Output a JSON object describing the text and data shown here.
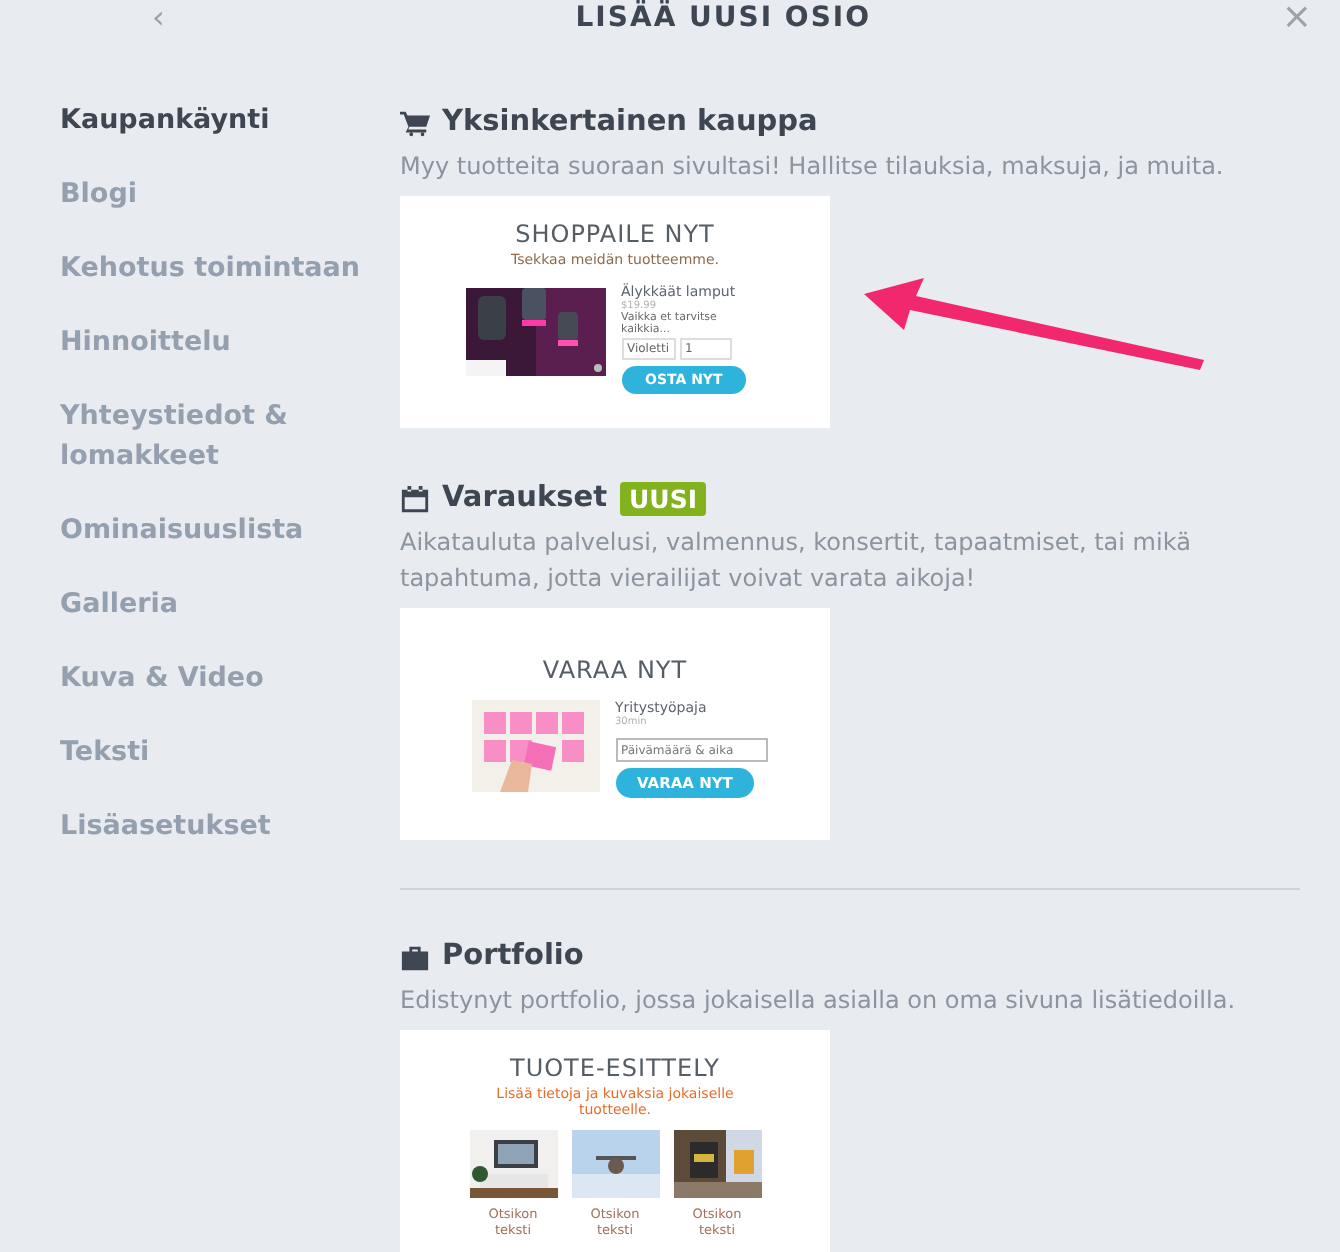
{
  "header": {
    "title": "LISÄÄ UUSI OSIO",
    "back": "‹",
    "close": "×"
  },
  "sidebar": {
    "items": [
      {
        "label": "Kaupankäynti",
        "selected": true
      },
      {
        "label": "Blogi",
        "selected": false
      },
      {
        "label": "Kehotus toimintaan",
        "selected": false
      },
      {
        "label": "Hinnoittelu",
        "selected": false
      },
      {
        "label": "Yhteystiedot & lomakkeet",
        "selected": false
      },
      {
        "label": "Ominaisuuslista",
        "selected": false
      },
      {
        "label": "Galleria",
        "selected": false
      },
      {
        "label": "Kuva & Video",
        "selected": false
      },
      {
        "label": "Teksti",
        "selected": false
      },
      {
        "label": "Lisäasetukset",
        "selected": false
      }
    ]
  },
  "sections": [
    {
      "kind": "shop",
      "title": "Yksinkertainen kauppa",
      "description": "Myy tuotteita suoraan sivultasi! Hallitse tilauksia, maksuja, ja muita.",
      "preview": {
        "title": "SHOPPAILE NYT",
        "subtitle": "Tsekkaa meidän tuotteemme.",
        "product": "Älykkäät lamput",
        "price": "$19.99",
        "text": "Vaikka et tarvitse kaikkia...",
        "option": "Violetti",
        "quantity": "1",
        "button": "OSTA NYT"
      }
    },
    {
      "kind": "booking",
      "title": "Varaukset",
      "badge": "UUSI",
      "description": "Aikatauluta palvelusi, valmennus, konsertit, tapaatmiset, tai mikä tapahtuma, jotta vierailijat voivat varata aikoja!",
      "preview": {
        "title": "VARAA NYT",
        "service": "Yritystyöpaja",
        "duration": "30min",
        "placeholder": "Päivämäärä & aika",
        "button": "VARAA NYT"
      }
    },
    {
      "kind": "portfolio",
      "title": "Portfolio",
      "description": "Edistynyt portfolio, jossa jokaisella asialla on oma sivuna lisätiedoilla.",
      "preview": {
        "title": "TUOTE-ESITTELY",
        "subtitle": "Lisää tietoja ja kuvaksia jokaiselle tuotteelle.",
        "items": [
          "Otsikon teksti",
          "Otsikon teksti",
          "Otsikon teksti"
        ]
      }
    }
  ],
  "annotations": [
    {
      "kind": "arrow",
      "color": "#f2286e"
    }
  ]
}
